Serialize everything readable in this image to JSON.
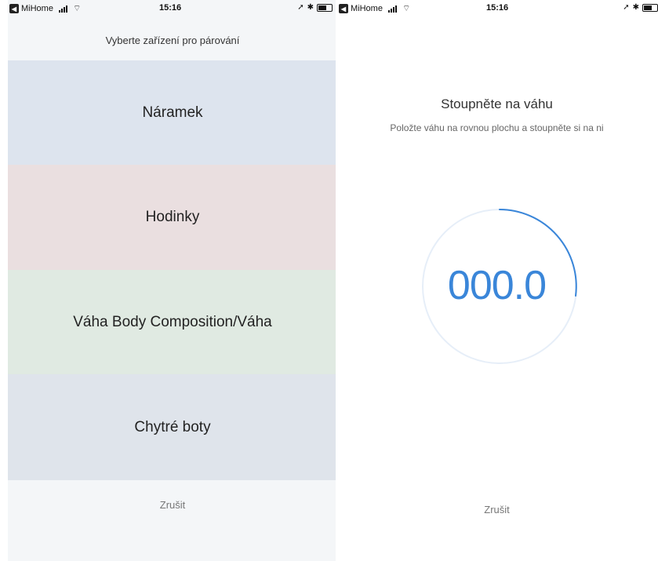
{
  "left_screen": {
    "status": {
      "app": "MiHome",
      "time": "15:16"
    },
    "title": "Vyberte zařízení pro párování",
    "devices": [
      {
        "label": "Náramek"
      },
      {
        "label": "Hodinky"
      },
      {
        "label": "Váha Body Composition/Váha"
      },
      {
        "label": "Chytré boty"
      }
    ],
    "cancel_label": "Zrušit"
  },
  "right_screen": {
    "status": {
      "app": "MiHome",
      "time": "15:16"
    },
    "title": "Stoupněte na váhu",
    "subtitle": "Položte váhu na rovnou plochu a stoupněte si na ni",
    "weight_display": "000.0",
    "cancel_label": "Zrušit"
  },
  "colors": {
    "accent": "#3a86d9",
    "item_1_bg": "#dde4ee",
    "item_2_bg": "#eadfe0",
    "item_3_bg": "#e0eae2",
    "item_4_bg": "#dfe4eb"
  }
}
